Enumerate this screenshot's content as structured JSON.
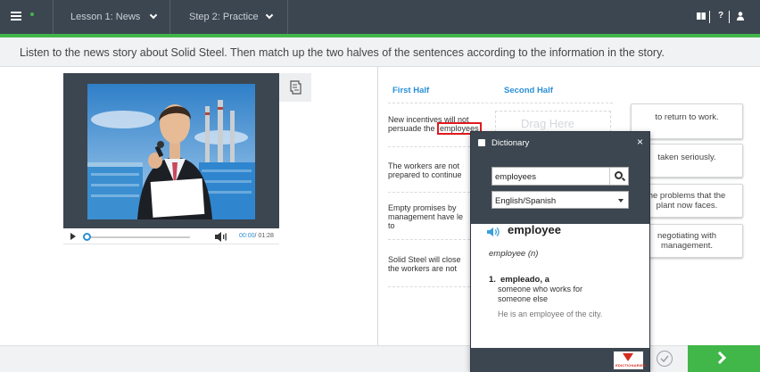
{
  "topbar": {
    "lesson_label": "Lesson 1: News",
    "step_label": "Step 2: Practice",
    "colors": {
      "bar": "#3c4650",
      "accent": "#41b649"
    }
  },
  "instruction": "Listen to the news story about Solid Steel. Then match up the two halves of the sentences according to the information in the story.",
  "player": {
    "current_time": "00:00",
    "total_time": "/ 01:28"
  },
  "table": {
    "first_half_header": "First Half",
    "second_half_header": "Second Half",
    "rows": [
      {
        "line1": "New incentives will not",
        "line2_pre": "persuade the ",
        "line2_highlight": "employees"
      },
      {
        "line1": "The workers are not",
        "line2_pre": "prepared to continue",
        "line2_highlight": ""
      },
      {
        "line1": "Empty promises by",
        "line2_pre": "management have le",
        "line3": "to"
      },
      {
        "line1": "Solid Steel will close",
        "line2_pre": "the workers are not",
        "line2_highlight": ""
      }
    ],
    "drop_placeholder": "Drag Here"
  },
  "choices": [
    {
      "line1": "to return to work.",
      "line2": ""
    },
    {
      "line1": "taken seriously.",
      "line2": ""
    },
    {
      "line1": "he problems that the",
      "line2": "plant now faces."
    },
    {
      "line1": "negotiating with",
      "line2": "management."
    }
  ],
  "dictionary": {
    "title": "Dictionary",
    "close": "×",
    "search_value": "employees",
    "language_selected": "English/Spanish",
    "headword": "employee",
    "part_of_speech": "employee (n)",
    "sense_number": "1.",
    "translation": "empleado, a",
    "definition": "someone who works for someone else",
    "example": "He is an employee of the city.",
    "logo_text": "EDICTIONARIES"
  },
  "icons": [
    "menu-icon",
    "book-icon",
    "help-icon",
    "user-icon",
    "transcript-icon",
    "play-icon",
    "volume-icon",
    "search-icon",
    "speaker-icon",
    "check-icon",
    "next-arrow-icon"
  ]
}
